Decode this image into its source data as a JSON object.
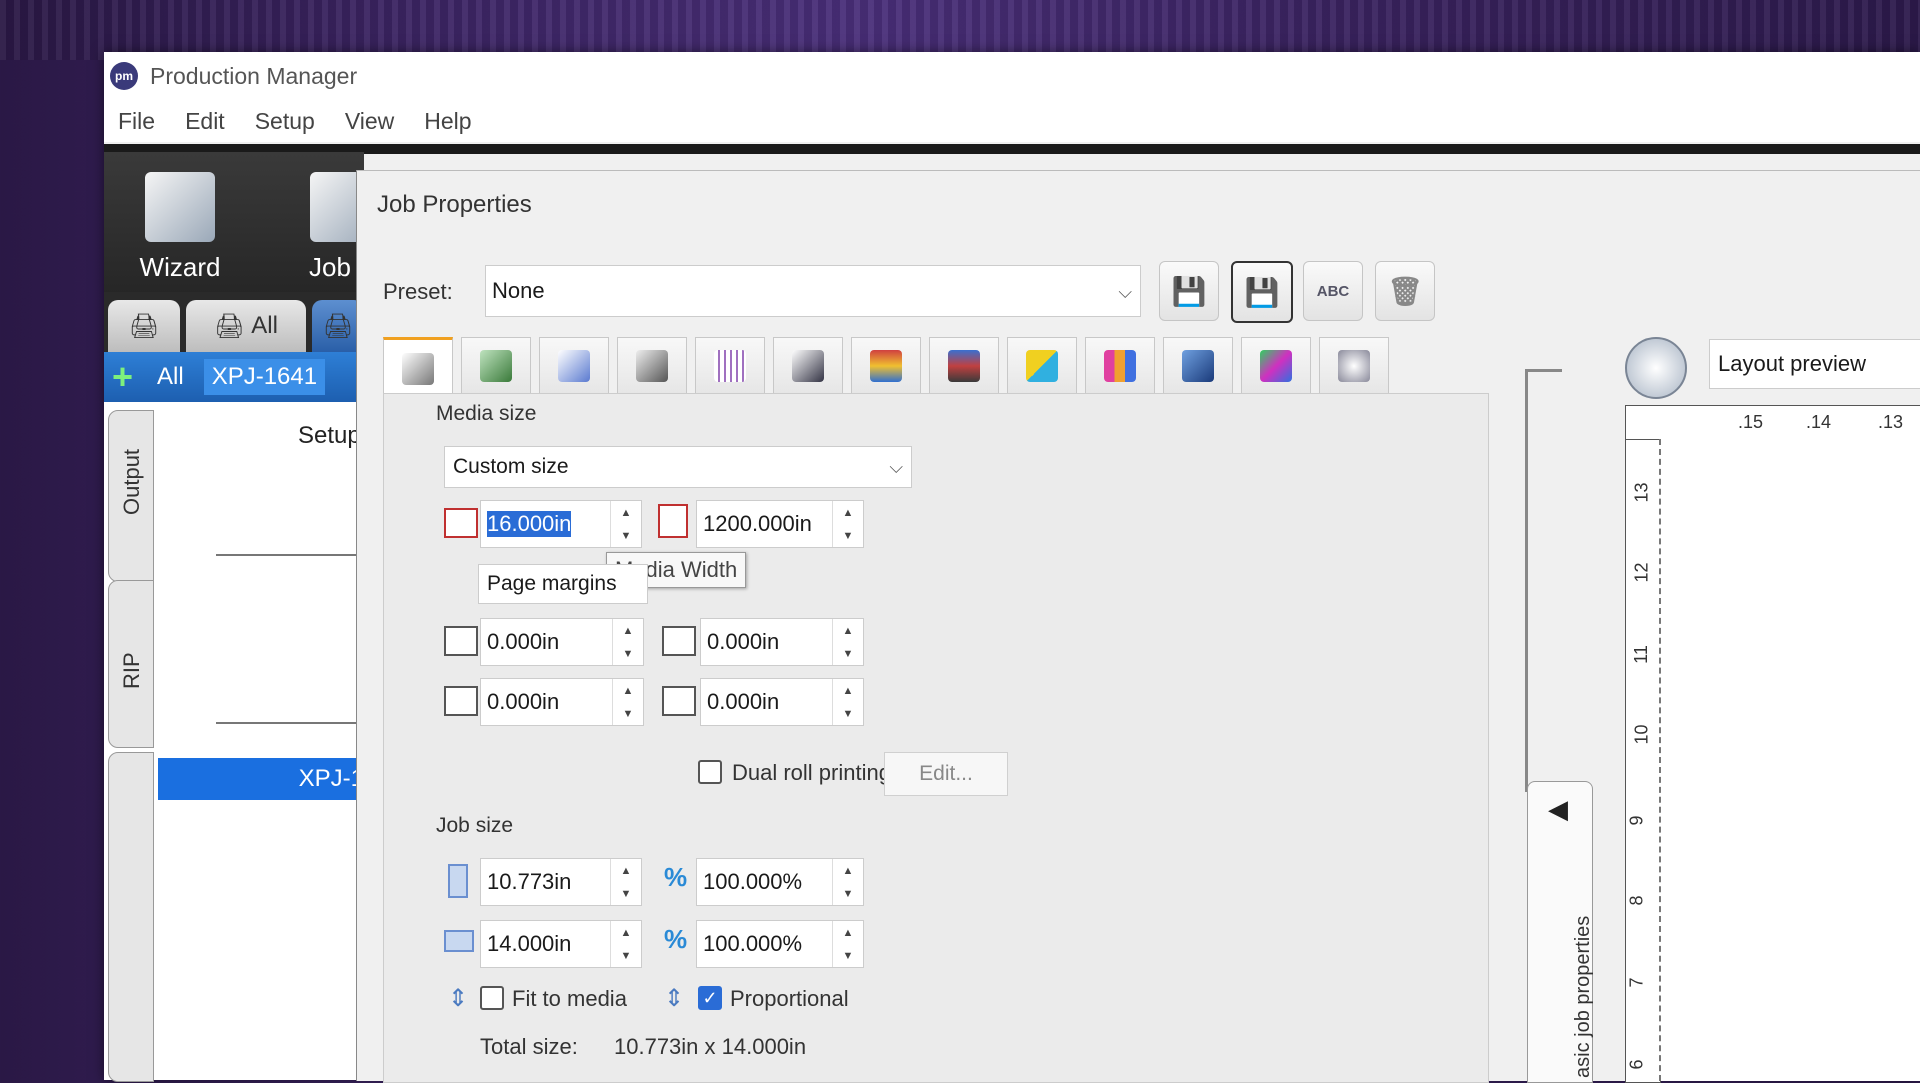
{
  "app": {
    "title": "Production Manager",
    "logo": "pm"
  },
  "menu": [
    "File",
    "Edit",
    "Setup",
    "View",
    "Help"
  ],
  "toolbar": {
    "wizard_label": "Wizard",
    "job_label": "Job"
  },
  "left": {
    "all_tab": "All",
    "filter_all": "All",
    "filter_printer": "XPJ-1641",
    "setup_label": "Setup",
    "output_tab": "Output",
    "rip_tab": "RIP",
    "job_row": "XPJ-1"
  },
  "dialog": {
    "title": "Job Properties",
    "preset_label": "Preset:",
    "preset_value": "None",
    "abc_label": "ABC"
  },
  "media": {
    "group_label": "Media size",
    "size_select": "Custom size",
    "width": "16.000in",
    "height": "1200.000in",
    "tooltip": "Media Width",
    "margins_select": "Page margins",
    "margin_left": "0.000in",
    "margin_top": "0.000in",
    "margin_right": "0.000in",
    "margin_bottom": "0.000in",
    "dual_roll_label": "Dual roll printing",
    "dual_roll_checked": false,
    "edit_button": "Edit..."
  },
  "job": {
    "group_label": "Job size",
    "width": "10.773in",
    "width_pct": "100.000%",
    "height": "14.000in",
    "height_pct": "100.000%",
    "pct_symbol": "%",
    "fit_label": "Fit to media",
    "fit_checked": false,
    "proportional_label": "Proportional",
    "proportional_checked": true,
    "total_label": "Total size:",
    "total_value": "10.773in x 14.000in"
  },
  "preview": {
    "title": "Layout preview",
    "collapse_label": "asic job properties",
    "ruler_top": [
      ".15",
      ".14",
      ".13"
    ],
    "ruler_left": [
      "13",
      "12",
      "11",
      "10",
      "9",
      "8",
      "7",
      "6"
    ]
  }
}
